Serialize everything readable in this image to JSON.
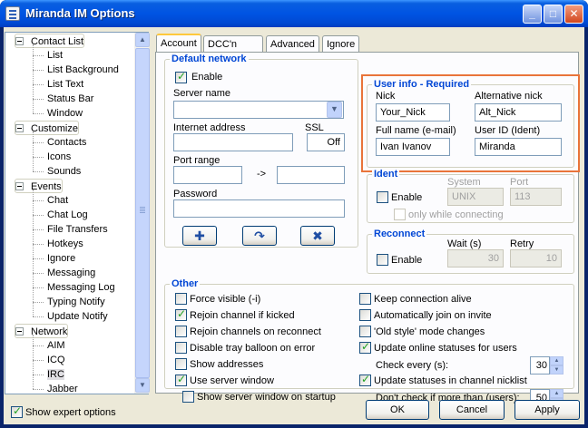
{
  "window": {
    "title": "Miranda IM Options"
  },
  "tree": {
    "groups": [
      {
        "label": "Contact List",
        "children": [
          "List",
          "List Background",
          "List Text",
          "Status Bar",
          "Window"
        ]
      },
      {
        "label": "Customize",
        "children": [
          "Contacts",
          "Icons",
          "Sounds"
        ]
      },
      {
        "label": "Events",
        "children": [
          "Chat",
          "Chat Log",
          "File Transfers",
          "Hotkeys",
          "Ignore",
          "Messaging",
          "Messaging Log",
          "Typing Notify",
          "Update Notify"
        ]
      },
      {
        "label": "Network",
        "children": [
          "AIM",
          "ICQ",
          "IRC",
          "Jabber"
        ]
      }
    ],
    "selected": "IRC"
  },
  "tabs": [
    "Account",
    "DCC'n CTCP",
    "Advanced",
    "Ignore"
  ],
  "default_network": {
    "title": "Default network",
    "enable_label": "Enable",
    "server_name_label": "Server name",
    "internet_address_label": "Internet address",
    "ssl_label": "SSL",
    "ssl_value": "Off",
    "port_range_label": "Port range",
    "port_sep": "->",
    "password_label": "Password"
  },
  "user_info": {
    "title": "User info - Required",
    "nick_label": "Nick",
    "nick_value": "Your_Nick",
    "alt_nick_label": "Alternative nick",
    "alt_nick_value": "Alt_Nick",
    "full_name_label": "Full name (e-mail)",
    "full_name_value": "Ivan Ivanov",
    "user_id_label": "User ID (Ident)",
    "user_id_value": "Miranda"
  },
  "ident": {
    "title": "Ident",
    "enable_label": "Enable",
    "system_label": "System",
    "system_value": "UNIX",
    "port_label": "Port",
    "port_value": "113",
    "only_label": "only while connecting"
  },
  "reconnect": {
    "title": "Reconnect",
    "enable_label": "Enable",
    "wait_label": "Wait (s)",
    "wait_value": "30",
    "retry_label": "Retry",
    "retry_value": "10"
  },
  "other": {
    "title": "Other",
    "left": [
      {
        "label": "Force visible (-i)",
        "checked": false
      },
      {
        "label": "Rejoin channel if kicked",
        "checked": true
      },
      {
        "label": "Rejoin channels on reconnect",
        "checked": false
      },
      {
        "label": "Disable tray balloon on error",
        "checked": false
      },
      {
        "label": "Show addresses",
        "checked": false
      },
      {
        "label": "Use server window",
        "checked": true
      },
      {
        "label": "Show server window on startup",
        "checked": false
      }
    ],
    "right": [
      {
        "label": "Keep connection alive",
        "checked": false
      },
      {
        "label": "Automatically join on invite",
        "checked": false
      },
      {
        "label": "'Old style' mode changes",
        "checked": false
      },
      {
        "label": "Update online statuses for users",
        "checked": true
      },
      {
        "label": "Update statuses in channel nicklist",
        "checked": true
      }
    ],
    "check_every_label": "Check every (s):",
    "check_every_value": "30",
    "dont_check_label": "Don't check if more than (users):",
    "dont_check_value": "50"
  },
  "bottom": {
    "show_expert_label": "Show expert options",
    "show_expert_checked": true,
    "ok_label": "OK",
    "cancel_label": "Cancel",
    "apply_label": "Apply"
  },
  "colors": {
    "accent_highlight": "#e9743a",
    "group_title": "#0046d5"
  }
}
